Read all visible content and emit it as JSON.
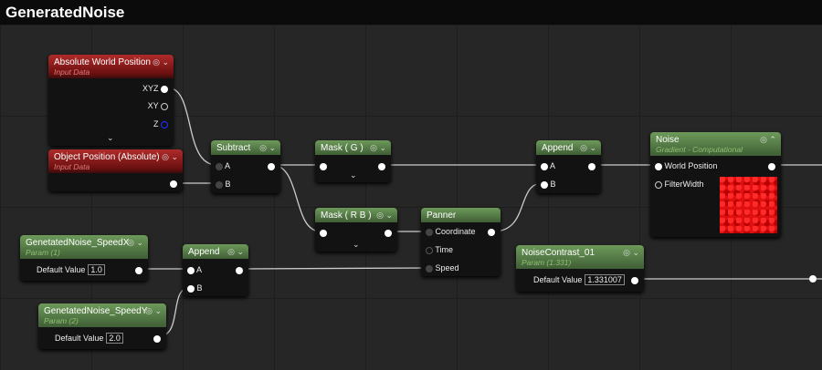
{
  "title": "GeneratedNoise",
  "nodes": {
    "awp": {
      "title": "Absolute World Position",
      "subtitle": "Input Data",
      "outputs": [
        "XYZ",
        "XY",
        "Z"
      ]
    },
    "objpos": {
      "title": "Object Position  (Absolute)",
      "subtitle": "Input Data"
    },
    "subtract": {
      "title": "Subtract",
      "inputs": [
        "A",
        "B"
      ]
    },
    "maskg": {
      "title": "Mask ( G )"
    },
    "maskrb": {
      "title": "Mask ( R B )"
    },
    "panner": {
      "title": "Panner",
      "inputs": [
        "Coordinate",
        "Time",
        "Speed"
      ]
    },
    "append1": {
      "title": "Append",
      "inputs": [
        "A",
        "B"
      ]
    },
    "noise": {
      "title": "Noise",
      "subtitle": "Gradient - Computational",
      "inputs": [
        "World Position",
        "FilterWidth"
      ],
      "preview_color": "#e01010"
    },
    "speedx": {
      "title": "GenetatedNoise_SpeedX",
      "subtitle": "Param (1)",
      "label": "Default Value",
      "value": "1.0"
    },
    "append2": {
      "title": "Append",
      "inputs": [
        "A",
        "B"
      ]
    },
    "speedy": {
      "title": "GenetatedNoise_SpeedY",
      "subtitle": "Param (2)",
      "label": "Default Value",
      "value": "2.0"
    },
    "contrast": {
      "title": "NoiseContrast_01",
      "subtitle": "Param (1.331)",
      "label": "Default Value",
      "value": "1.331007"
    }
  }
}
